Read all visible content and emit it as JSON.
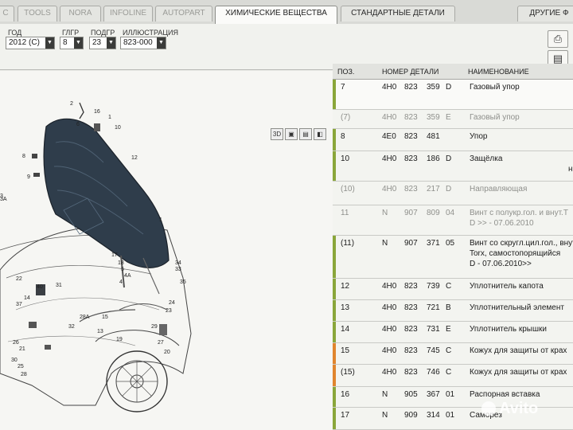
{
  "tabs": [
    "C",
    "TOOLS",
    "NORA",
    "INFOLINE",
    "AUTOPART",
    "ХИМИЧЕСКИЕ ВЕЩЕСТВА",
    "СТАНДАРТНЫЕ ДЕТАЛИ",
    "ДРУГИЕ Ф"
  ],
  "filters": {
    "year_label": "ГОД",
    "year_value": "2012 (C)",
    "group_label": "ГЛГР",
    "group_value": "8",
    "subgroup_label": "ПОДГР",
    "subgroup_value": "23",
    "illustration_label": "ИЛЛЮСТРАЦИЯ",
    "illustration_value": "823-000"
  },
  "view_tools": [
    "3D",
    "▣",
    "▤",
    "◧"
  ],
  "table": {
    "headers": {
      "pos": "ПОЗ.",
      "part_no": "НОМЕР ДЕТАЛИ",
      "name": "НАИМЕНОВАНИЕ"
    },
    "rows": [
      {
        "pos": "7",
        "a": "4H0",
        "b": "823",
        "c": "359",
        "d": "D",
        "name": "Газовый упор",
        "name2": "",
        "name3": "",
        "dim": false,
        "bar": "#8aa63a"
      },
      {
        "pos": "(7)",
        "a": "4H0",
        "b": "823",
        "c": "359",
        "d": "E",
        "name": "Газовый упор",
        "name2": "",
        "name3": "",
        "dim": true,
        "bar": ""
      },
      {
        "pos": "8",
        "a": "4E0",
        "b": "823",
        "c": "481",
        "d": "",
        "name": "Упор",
        "name2": "",
        "name3": "",
        "dim": false,
        "bar": "#8aa63a"
      },
      {
        "pos": "10",
        "a": "4H0",
        "b": "823",
        "c": "186",
        "d": "D",
        "name": "Защёлка",
        "name2": "н",
        "name3": "",
        "dim": false,
        "bar": "#8aa63a"
      },
      {
        "pos": "(10)",
        "a": "4H0",
        "b": "823",
        "c": "217",
        "d": "D",
        "name": "Направляющая",
        "name2": "",
        "name3": "",
        "dim": true,
        "bar": ""
      },
      {
        "pos": "11",
        "a": "N",
        "b": "907",
        "c": "809",
        "d": "04",
        "name": "Винт с полукр.гол. и внут.Т",
        "name2": "D >> - 07.06.2010",
        "name3": "",
        "dim": true,
        "bar": ""
      },
      {
        "pos": "(11)",
        "a": "N",
        "b": "907",
        "c": "371",
        "d": "05",
        "name": "Винт со скругл.цил.гол., внут",
        "name2": "Torx, самостопорящийся",
        "name3": "D - 07.06.2010>>",
        "dim": false,
        "bar": "#8aa63a"
      },
      {
        "pos": "12",
        "a": "4H0",
        "b": "823",
        "c": "739",
        "d": "C",
        "name": "Уплотнитель капота",
        "name2": "",
        "name3": "",
        "dim": false,
        "bar": "#8aa63a"
      },
      {
        "pos": "13",
        "a": "4H0",
        "b": "823",
        "c": "721",
        "d": "B",
        "name": "Уплотнительный элемент",
        "name2": "",
        "name3": "",
        "dim": false,
        "bar": "#8aa63a"
      },
      {
        "pos": "14",
        "a": "4H0",
        "b": "823",
        "c": "731",
        "d": "E",
        "name": "Уплотнитель крышки",
        "name2": "",
        "name3": "",
        "dim": false,
        "bar": "#8aa63a"
      },
      {
        "pos": "15",
        "a": "4H0",
        "b": "823",
        "c": "745",
        "d": "C",
        "name": "Кожух для защиты от крах",
        "name2": "",
        "name3": "",
        "dim": false,
        "bar": "#e0852e"
      },
      {
        "pos": "(15)",
        "a": "4H0",
        "b": "823",
        "c": "746",
        "d": "C",
        "name": "Кожух для защиты от крах",
        "name2": "",
        "name3": "",
        "dim": false,
        "bar": "#e0852e"
      },
      {
        "pos": "16",
        "a": "N",
        "b": "905",
        "c": "367",
        "d": "01",
        "name": "Распорная вставка",
        "name2": "",
        "name3": "",
        "dim": false,
        "bar": "#8aa63a"
      },
      {
        "pos": "17",
        "a": "N",
        "b": "909",
        "c": "314",
        "d": "01",
        "name": "Саморез",
        "name2": "",
        "name3": "",
        "dim": false,
        "bar": "#8aa63a"
      }
    ]
  },
  "diagram_callouts": [
    "2",
    "16",
    "1",
    "10",
    "12",
    "6",
    "8",
    "9",
    "1",
    "3",
    "17",
    "18",
    "5",
    "4A",
    "4",
    "34",
    "35",
    "33",
    "24",
    "23",
    "22",
    "40",
    "31",
    "14",
    "37",
    "28A",
    "32",
    "15",
    "13",
    "29",
    "26",
    "21",
    "30",
    "25",
    "28",
    "27",
    "20",
    "19",
    "3A"
  ],
  "watermark": "Avito"
}
